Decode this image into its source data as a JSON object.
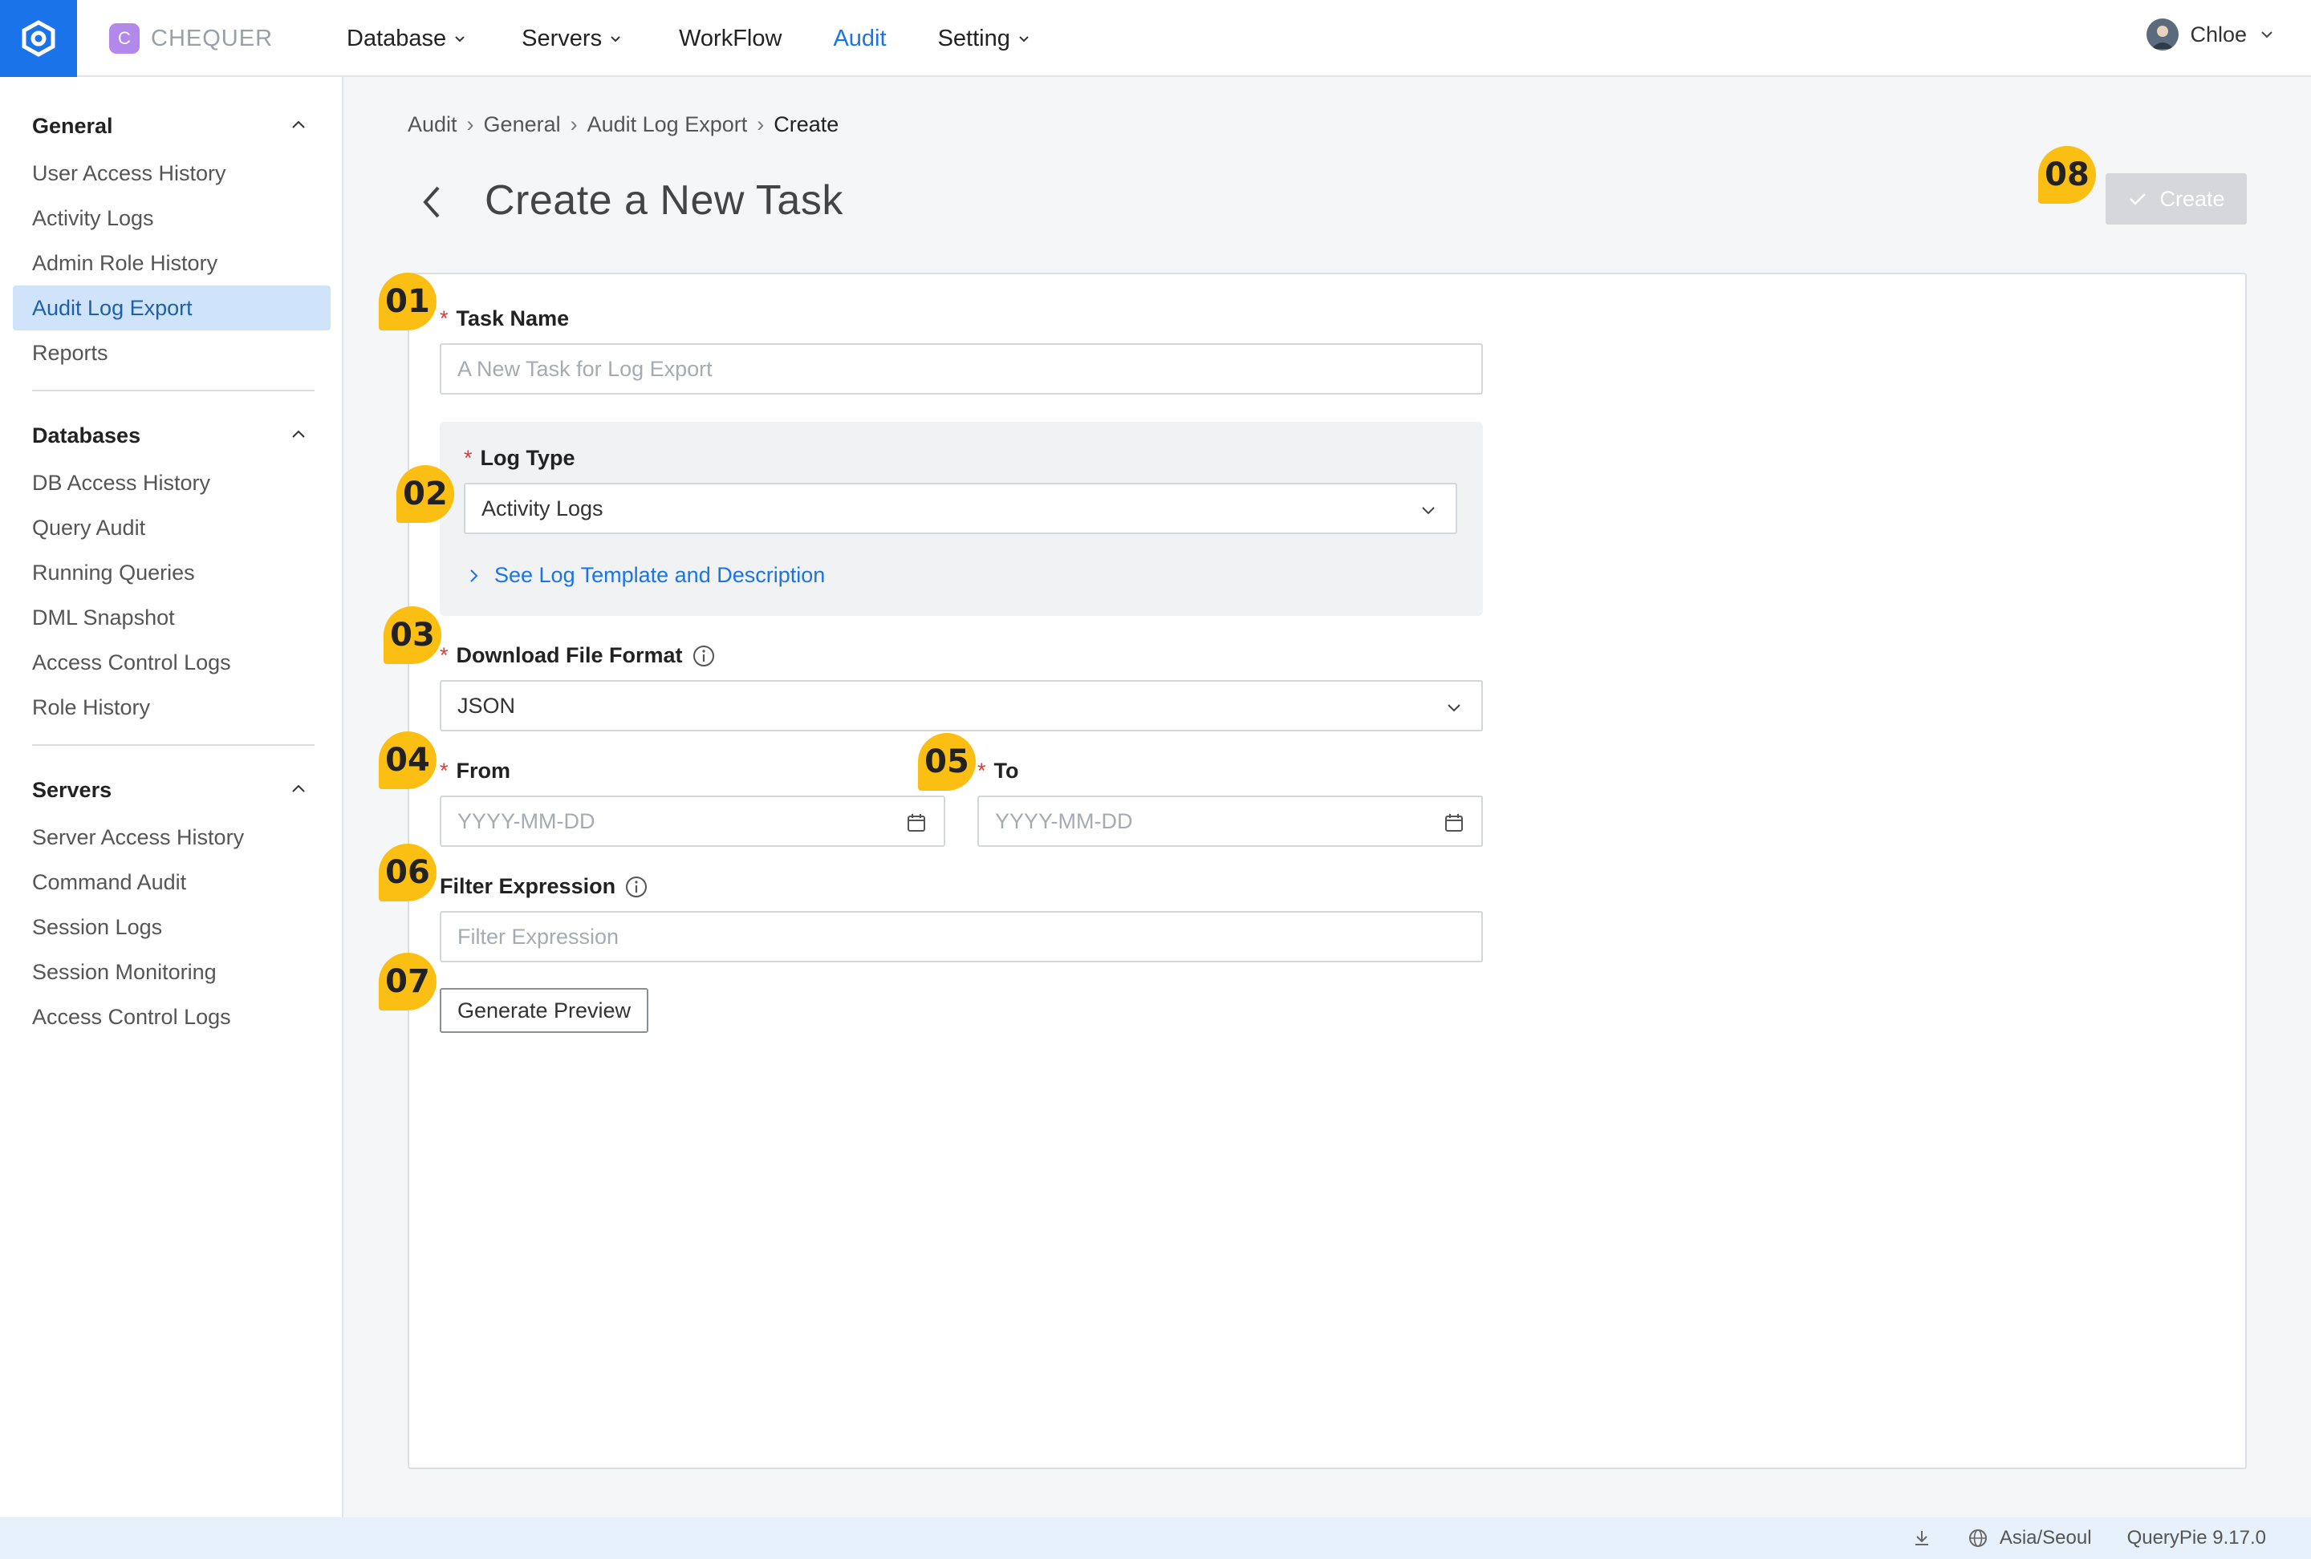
{
  "brand": {
    "name": "CHEQUER",
    "mark": "C"
  },
  "nav": {
    "items": [
      {
        "label": "Database",
        "has_dropdown": true
      },
      {
        "label": "Servers",
        "has_dropdown": true
      },
      {
        "label": "WorkFlow",
        "has_dropdown": false
      },
      {
        "label": "Audit",
        "has_dropdown": false,
        "active": true
      },
      {
        "label": "Setting",
        "has_dropdown": true
      }
    ]
  },
  "user": {
    "name": "Chloe"
  },
  "sidebar": {
    "groups": [
      {
        "title": "General",
        "items": [
          "User Access History",
          "Activity Logs",
          "Admin Role History",
          "Audit Log Export",
          "Reports"
        ]
      },
      {
        "title": "Databases",
        "items": [
          "DB Access History",
          "Query Audit",
          "Running Queries",
          "DML Snapshot",
          "Access Control Logs",
          "Role History"
        ]
      },
      {
        "title": "Servers",
        "items": [
          "Server Access History",
          "Command Audit",
          "Session Logs",
          "Session Monitoring",
          "Access Control Logs"
        ]
      }
    ],
    "active_item": "Audit Log Export"
  },
  "breadcrumb": [
    "Audit",
    "General",
    "Audit Log Export",
    "Create"
  ],
  "page": {
    "title": "Create a New Task",
    "create_label": "Create"
  },
  "form": {
    "task_name": {
      "label": "Task Name",
      "placeholder": "A New Task for Log Export"
    },
    "log_type": {
      "label": "Log Type",
      "value": "Activity Logs",
      "link": "See Log Template and Description"
    },
    "file_format": {
      "label": "Download File Format",
      "value": "JSON"
    },
    "from": {
      "label": "From",
      "placeholder": "YYYY-MM-DD"
    },
    "to": {
      "label": "To",
      "placeholder": "YYYY-MM-DD"
    },
    "filter": {
      "label": "Filter Expression",
      "placeholder": "Filter Expression"
    },
    "generate_label": "Generate Preview",
    "required_mark": "*"
  },
  "badges": [
    "01",
    "02",
    "03",
    "04",
    "05",
    "06",
    "07",
    "08"
  ],
  "footer": {
    "timezone": "Asia/Seoul",
    "version": "QueryPie 9.17.0"
  },
  "colors": {
    "accent": "#1a73e8",
    "badge": "#fbbf14",
    "active_item_bg": "#cfe4fb",
    "required": "#e53935"
  },
  "icons": [
    "chequer-logo-icon",
    "chevron-down-icon",
    "chevron-up-icon",
    "chevron-left-icon",
    "chevron-right-icon",
    "check-icon",
    "info-icon",
    "calendar-icon",
    "download-icon",
    "globe-icon",
    "avatar"
  ]
}
